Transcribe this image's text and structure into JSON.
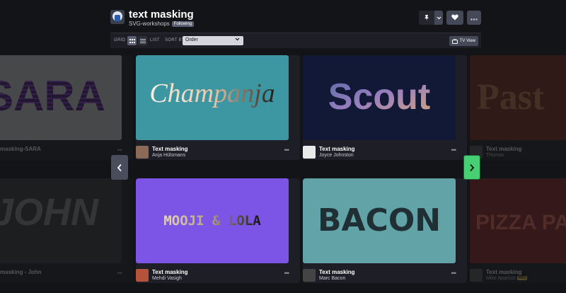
{
  "collection": {
    "title": "text masking",
    "owner": "SVG-workshops",
    "following_badge": "Following"
  },
  "header_icons": {
    "pin": "pin-icon",
    "caret": "chevron-down-icon",
    "heart": "heart-icon",
    "more": "more-icon"
  },
  "toolbar": {
    "grid_label": "GRID",
    "list_label": "LIST",
    "sort_label": "SORT BY",
    "sort_value": "Order",
    "tv_label": "TV View"
  },
  "pens": [
    {
      "title": "masking-SARA",
      "user": "",
      "art": "SARA",
      "bg": "#cfcfcf",
      "fill": "#5b2a86"
    },
    {
      "title": "Text masking",
      "user": "Anja Hülsmans",
      "art": "Champanja",
      "bg": "#3d97a3",
      "fill": "#f6e4d2"
    },
    {
      "title": "Text masking",
      "user": "Joyce Johnston",
      "art": "Scout",
      "bg": "#111936",
      "fill": "#7b6fa8"
    },
    {
      "title": "Text masking",
      "user": "Thomas",
      "art": "Past",
      "bg": "#7a2a18",
      "fill": "#b85a36"
    },
    {
      "title": "masking - John",
      "user": "",
      "art": "JOHN",
      "bg": "#3a3a3a",
      "fill": "#7a7a7a"
    },
    {
      "title": "Text masking",
      "user": "Mehdi Vasigh",
      "art": "MOOJI & LOLA",
      "bg": "#7c55e6",
      "fill": "#d9c4a0"
    },
    {
      "title": "Text masking",
      "user": "Marc Bacon",
      "art": "BACON",
      "bg": "#62a3a8",
      "fill": "#1f2f33"
    },
    {
      "title": "Text masking",
      "user": "Mike Aparicio",
      "art": "PIZZA PA",
      "bg": "#8a2323",
      "fill": "#e85a4a",
      "badge": "PRO"
    }
  ],
  "nav": {
    "prev_icon": "chevron-left-icon",
    "next_icon": "chevron-right-icon"
  }
}
